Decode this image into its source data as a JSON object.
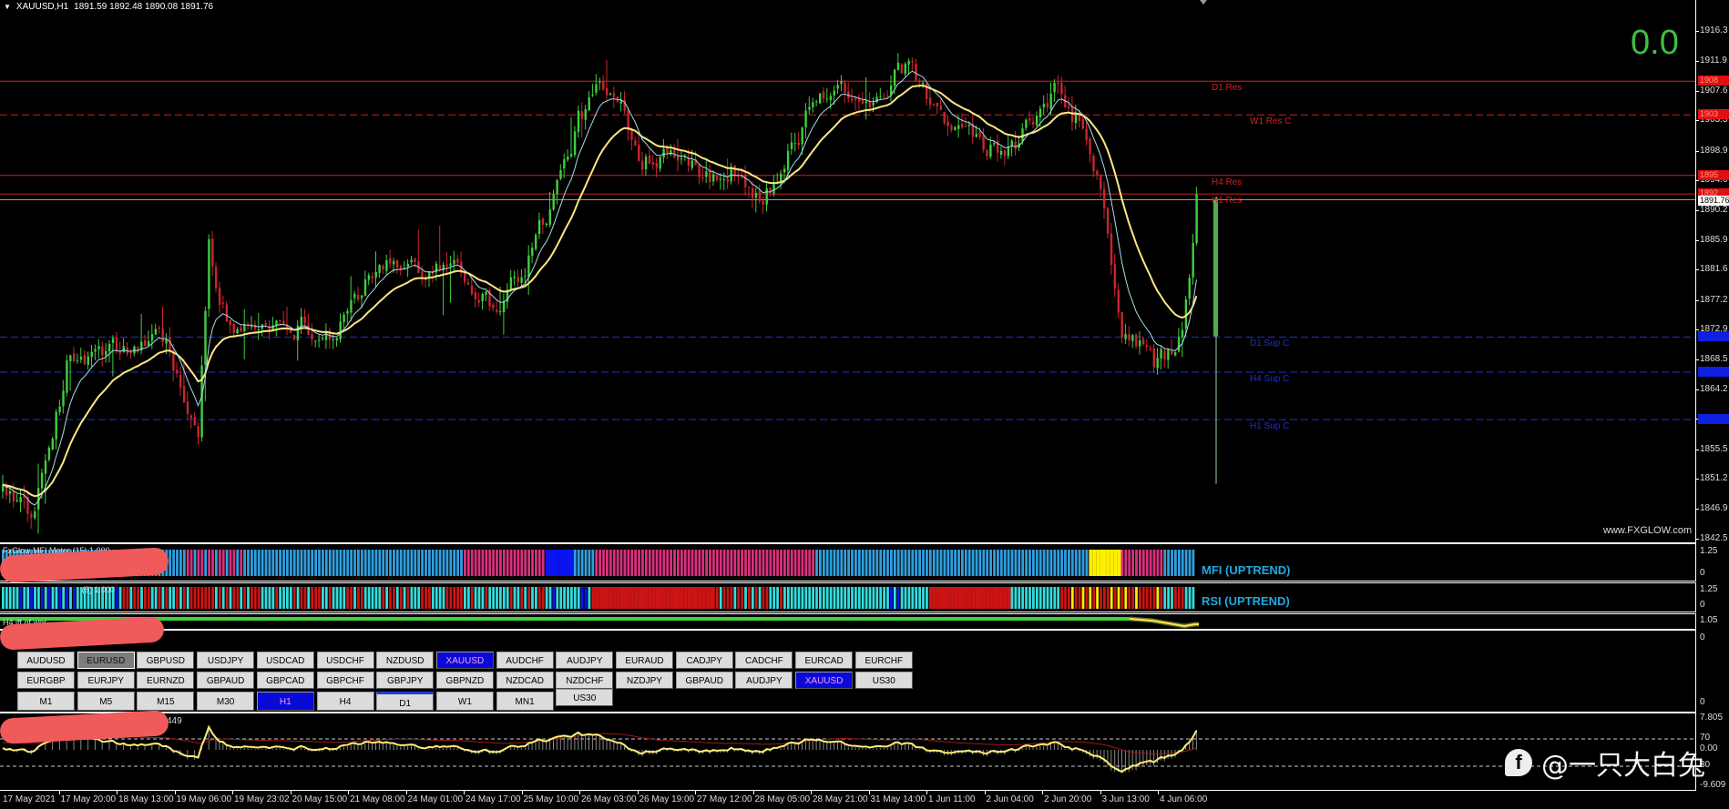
{
  "header": {
    "menu_icon": "triangle-down-icon",
    "symbol": "XAUUSD,H1",
    "ohlc": "1891.59 1892.48 1890.08 1891.76"
  },
  "spread_display": "0.0",
  "site_watermark": "www.FXGLOW.com",
  "social_watermark": "@一只大白兔",
  "colors": {
    "bull": "#3fcf3f",
    "bear": "#c8262f",
    "ma_fast": "#a8dce8",
    "ma_slow": "#ffe680",
    "res": "#d42020",
    "sup": "#2030d0",
    "spread": "#3fbf3f"
  },
  "price_axis": [
    "1916.3",
    "1911.9",
    "1907.6",
    "1903.3",
    "1898.9",
    "1894.6",
    "1890.2",
    "1885.9",
    "1881.6",
    "1877.2",
    "1872.9",
    "1868.5",
    "1864.2",
    "1859.9",
    "1855.5",
    "1851.2",
    "1846.9",
    "1842.5"
  ],
  "levels": [
    {
      "label": "D1 Res",
      "price": 1909.0,
      "tag": "1908",
      "kind": "res",
      "style": "solid",
      "label_offset": 0
    },
    {
      "label": "W1 Res C",
      "price": 1904.1,
      "tag": "1903",
      "kind": "res",
      "style": "dashed",
      "label_offset": 1
    },
    {
      "label": "H4 Res",
      "price": 1895.3,
      "tag": "1895",
      "kind": "res",
      "style": "solid",
      "label_offset": 0
    },
    {
      "label": "H1 Res",
      "price": 1892.6,
      "tag": "1892",
      "kind": "res",
      "style": "solid",
      "label_offset": 0
    },
    {
      "label": "D1 Sup C",
      "price": 1871.8,
      "tag": "",
      "kind": "sup",
      "style": "dashed",
      "label_offset": 1
    },
    {
      "label": "H4 Sup C",
      "price": 1866.7,
      "tag": "",
      "kind": "sup",
      "style": "dashed",
      "label_offset": 1
    },
    {
      "label": "H1 Sup C",
      "price": 1859.8,
      "tag": "",
      "kind": "sup",
      "style": "dashed",
      "label_offset": 1
    }
  ],
  "current_price": 1891.76,
  "current_price_tag": "1891.76",
  "chart_data": {
    "type": "candlestick",
    "symbol": "XAUUSD",
    "timeframe": "H1",
    "bars": 337,
    "ylim": [
      1842.5,
      1916.3
    ],
    "anchors": [
      [
        0,
        1851.8
      ],
      [
        9,
        1845.4
      ],
      [
        18,
        1867.8
      ],
      [
        31,
        1869.5
      ],
      [
        46,
        1871.1
      ],
      [
        55,
        1856.6
      ],
      [
        58,
        1885.0
      ],
      [
        64,
        1872.7
      ],
      [
        80,
        1874.3
      ],
      [
        92,
        1872.7
      ],
      [
        104,
        1880.7
      ],
      [
        116,
        1882.3
      ],
      [
        128,
        1883.1
      ],
      [
        138,
        1875.9
      ],
      [
        147,
        1882.3
      ],
      [
        156,
        1893.5
      ],
      [
        162,
        1903.1
      ],
      [
        168,
        1908.0
      ],
      [
        174,
        1904.7
      ],
      [
        180,
        1898.3
      ],
      [
        190,
        1899.9
      ],
      [
        199,
        1895.1
      ],
      [
        208,
        1896.7
      ],
      [
        214,
        1891.9
      ],
      [
        220,
        1896.7
      ],
      [
        226,
        1903.1
      ],
      [
        232,
        1908.0
      ],
      [
        245,
        1907.2
      ],
      [
        254,
        1911.2
      ],
      [
        260,
        1906.4
      ],
      [
        266,
        1901.5
      ],
      [
        275,
        1899.9
      ],
      [
        284,
        1898.3
      ],
      [
        290,
        1903.1
      ],
      [
        297,
        1908.0
      ],
      [
        303,
        1903.1
      ],
      [
        309,
        1893.5
      ],
      [
        312,
        1880.7
      ],
      [
        315,
        1872.7
      ],
      [
        321,
        1871.1
      ],
      [
        324,
        1867.8
      ],
      [
        330,
        1869.5
      ],
      [
        334,
        1879.1
      ],
      [
        336,
        1891.9
      ]
    ],
    "htf_candle": {
      "open": 1871.9,
      "close": 1891.9,
      "high": 1892.2,
      "low": 1850.5
    },
    "ma_periods": [
      8,
      21
    ]
  },
  "indicators": {
    "mfi": {
      "label": "FxGlow MFI Meter (15) 1.000",
      "trend": "MFI (UPTREND)",
      "axis": [
        "1.25",
        "0"
      ],
      "palette": {
        "up": "#2f9fe0",
        "down": "#d8307e",
        "strong": "#0a14f0",
        "yellow": "#ffee00"
      },
      "segments": [
        [
          "up",
          51
        ],
        [
          "mixUD",
          17
        ],
        [
          "up",
          62
        ],
        [
          "down",
          23
        ],
        [
          "strong",
          8
        ],
        [
          "up",
          6
        ],
        [
          "down",
          62
        ],
        [
          "up",
          77
        ],
        [
          "yellow",
          9
        ],
        [
          "down",
          12
        ],
        [
          "up",
          9
        ]
      ]
    },
    "rsi": {
      "label": "(8) 1.000",
      "trend": "RSI (UPTREND)",
      "axis": [
        "1.25",
        "0"
      ],
      "palette": {
        "cyan": "#33dcdc",
        "red": "#cc1414",
        "blue": "#0a14f0",
        "yellow": "#ffee00"
      },
      "segments": [
        [
          "blueC",
          34
        ],
        [
          "mixRC",
          120
        ],
        [
          "blueC",
          12
        ],
        [
          "red",
          34
        ],
        [
          "mixRC",
          20
        ],
        [
          "cyan",
          29
        ],
        [
          "blueC",
          12
        ],
        [
          "red",
          23
        ],
        [
          "cyan",
          14
        ],
        [
          "redY",
          28
        ],
        [
          "mixRC",
          10
        ]
      ]
    },
    "h4": {
      "label": "H4 ift of wpr",
      "axis": "1.05"
    },
    "buttons_panel": {
      "axis_top": "0",
      "axis_bottom": "0"
    },
    "osc": {
      "label": "449",
      "axis": [
        "7.805",
        "70",
        "0.00",
        "30",
        "-9.609"
      ]
    }
  },
  "symbol_buttons": [
    [
      {
        "label": "AUDUSD",
        "state": ""
      },
      {
        "label": "EURUSD",
        "state": "sel-gray"
      },
      {
        "label": "GBPUSD",
        "state": ""
      },
      {
        "label": "USDJPY",
        "state": ""
      },
      {
        "label": "USDCAD",
        "state": ""
      },
      {
        "label": "USDCHF",
        "state": ""
      },
      {
        "label": "NZDUSD",
        "state": ""
      },
      {
        "label": "XAUUSD",
        "state": "sel-blue"
      },
      {
        "label": "AUDCHF",
        "state": ""
      },
      {
        "label": "AUDJPY",
        "state": ""
      },
      {
        "label": "EURAUD",
        "state": ""
      },
      {
        "label": "CADJPY",
        "state": ""
      },
      {
        "label": "CADCHF",
        "state": ""
      },
      {
        "label": "EURCAD",
        "state": ""
      },
      {
        "label": "EURCHF",
        "state": ""
      }
    ],
    [
      {
        "label": "EURGBP",
        "state": ""
      },
      {
        "label": "EURJPY",
        "state": ""
      },
      {
        "label": "EURNZD",
        "state": ""
      },
      {
        "label": "GBPAUD",
        "state": ""
      },
      {
        "label": "GBPCAD",
        "state": ""
      },
      {
        "label": "GBPCHF",
        "state": ""
      },
      {
        "label": "GBPJPY",
        "state": ""
      },
      {
        "label": "GBPNZD",
        "state": ""
      },
      {
        "label": "NZDCAD",
        "state": ""
      },
      {
        "label": "NZDCHF",
        "state": ""
      },
      {
        "label": "NZDJPY",
        "state": ""
      },
      {
        "label": "GBPAUD",
        "state": ""
      },
      {
        "label": "AUDJPY",
        "state": ""
      },
      {
        "label": "XAUUSD",
        "state": "sel-blue"
      },
      {
        "label": "US30",
        "state": ""
      }
    ],
    [
      {
        "label": "M1",
        "state": ""
      },
      {
        "label": "M5",
        "state": ""
      },
      {
        "label": "M15",
        "state": ""
      },
      {
        "label": "M30",
        "state": ""
      },
      {
        "label": "H1",
        "state": "sel-blue"
      },
      {
        "label": "H4",
        "state": ""
      },
      {
        "label": "D1",
        "state": "top-blue"
      },
      {
        "label": "W1",
        "state": ""
      },
      {
        "label": "MN1",
        "state": ""
      },
      {
        "label": "US30",
        "state": ""
      }
    ]
  ],
  "time_axis": [
    "17 May 2021",
    "17 May 20:00",
    "18 May 13:00",
    "19 May 06:00",
    "19 May 23:02",
    "20 May 15:00",
    "21 May 08:00",
    "24 May 01:00",
    "24 May 17:00",
    "25 May 10:00",
    "26 May 03:00",
    "26 May 19:00",
    "27 May 12:00",
    "28 May 05:00",
    "28 May 21:00",
    "31 May 14:00",
    "1 Jun 11:00",
    "2 Jun 04:00",
    "2 Jun 20:00",
    "3 Jun 13:00",
    "4 Jun 06:00"
  ]
}
